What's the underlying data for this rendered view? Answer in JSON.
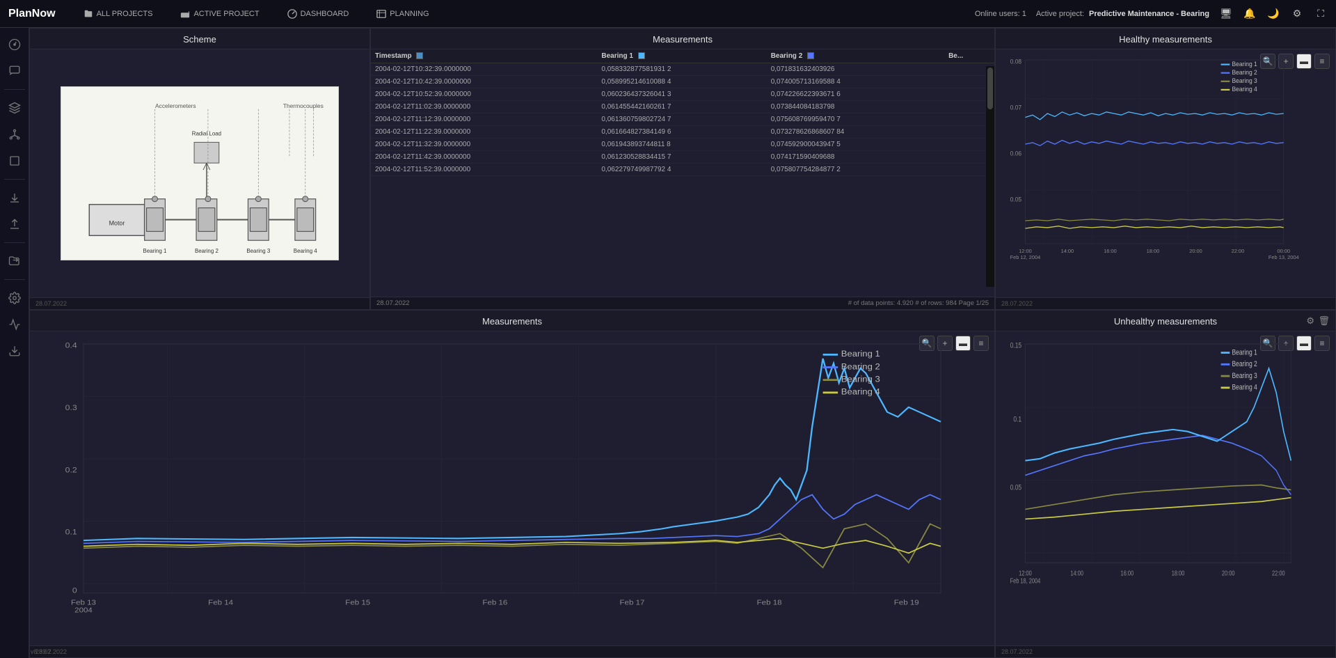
{
  "app": {
    "logo": "PlanNow",
    "version": "v8.39.2"
  },
  "topbar": {
    "nav_items": [
      {
        "label": "ALL PROJECTS",
        "icon": "folder-icon"
      },
      {
        "label": "ACTIVE PROJECT",
        "icon": "folder-open-icon"
      },
      {
        "label": "DASHBOARD",
        "icon": "dashboard-icon"
      },
      {
        "label": "PLANNING",
        "icon": "planning-icon"
      }
    ],
    "status": "Online users: 1",
    "active_project": "Active project:",
    "project_name": "Predictive Maintenance - Bearing"
  },
  "sidebar_icons": [
    "speedometer",
    "comment",
    "layers",
    "network",
    "square",
    "download",
    "upload",
    "folder-share",
    "settings",
    "chart",
    "download2"
  ],
  "panels": {
    "scheme": {
      "title": "Scheme",
      "footer": "28.07.2022"
    },
    "measurements_table": {
      "title": "Measurements",
      "footer_left": "28.07.2022",
      "footer_right": "# of data points: 4.920  # of rows: 984  Page 1/25",
      "columns": [
        "Timestamp",
        "Bearing 1",
        "Bearing 2",
        "Be..."
      ],
      "rows": [
        [
          "2004-02-12T10:32:39.0000000",
          "0,058332877581931 2",
          "0,071831632403926"
        ],
        [
          "2004-02-12T10:42:39.0000000",
          "0,058995214610088 4",
          "0,074005713169588 4"
        ],
        [
          "2004-02-12T10:52:39.0000000",
          "0,060236437326041 3",
          "0,074226622393671 6"
        ],
        [
          "2004-02-12T11:02:39.0000000",
          "0,061455442160261 7",
          "0,073844084183798"
        ],
        [
          "2004-02-12T11:12:39.0000000",
          "0,061360759802724 7",
          "0,075608769959470 7"
        ],
        [
          "2004-02-12T11:22:39.0000000",
          "0,061664827384149 6",
          "0,073278626868607 84"
        ],
        [
          "2004-02-12T11:32:39.0000000",
          "0,061943893744811 8",
          "0,074592900043947 5"
        ],
        [
          "2004-02-12T11:42:39.0000000",
          "0,061230528834415 7",
          "0,074171590409688"
        ],
        [
          "2004-02-12T11:52:39.0000000",
          "0,062279749987792 4",
          "0,075807754284877 2"
        ]
      ]
    },
    "healthy": {
      "title": "Healthy measurements",
      "footer": "28.07.2022",
      "y_ticks": [
        "0.08",
        "0.07",
        "0.06",
        "0.05"
      ],
      "x_labels": [
        "12:00\nFeb 12, 2004",
        "14:00",
        "16:00",
        "18:00",
        "20:00",
        "22:00",
        "00:00\nFeb 13, 2004"
      ],
      "legend": [
        {
          "label": "Bearing 1",
          "color": "#4db8ff"
        },
        {
          "label": "Bearing 2",
          "color": "#5577ff"
        },
        {
          "label": "Bearing 3",
          "color": "#888855"
        },
        {
          "label": "Bearing 4",
          "color": "#cccc44"
        }
      ]
    },
    "measurements_chart": {
      "title": "Measurements",
      "footer": "28.07.2022",
      "y_ticks": [
        "0.4",
        "0.3",
        "0.2",
        "0.1",
        "0"
      ],
      "x_labels": [
        "Feb 13\n2004",
        "Feb 14",
        "Feb 15",
        "Feb 16",
        "Feb 17",
        "Feb 18",
        "Feb 19"
      ],
      "legend": [
        {
          "label": "Bearing 1",
          "color": "#4db8ff"
        },
        {
          "label": "Bearing 2",
          "color": "#5577ff"
        },
        {
          "label": "Bearing 3",
          "color": "#888855"
        },
        {
          "label": "Bearing 4",
          "color": "#cccc44"
        }
      ]
    },
    "unhealthy": {
      "title": "Unhealthy measurements",
      "footer": "28.07.2022",
      "y_ticks": [
        "0.15",
        "0.1",
        "0.05"
      ],
      "x_labels": [
        "12:00\nFeb 18, 2004",
        "14:00",
        "16:00",
        "18:00",
        "20:00",
        "22:00"
      ],
      "legend": [
        {
          "label": "Bearing 1",
          "color": "#4db8ff"
        },
        {
          "label": "Bearing 2",
          "color": "#5577ff"
        },
        {
          "label": "Bearing 3",
          "color": "#888855"
        },
        {
          "label": "Bearing 4",
          "color": "#cccc44"
        }
      ]
    }
  }
}
